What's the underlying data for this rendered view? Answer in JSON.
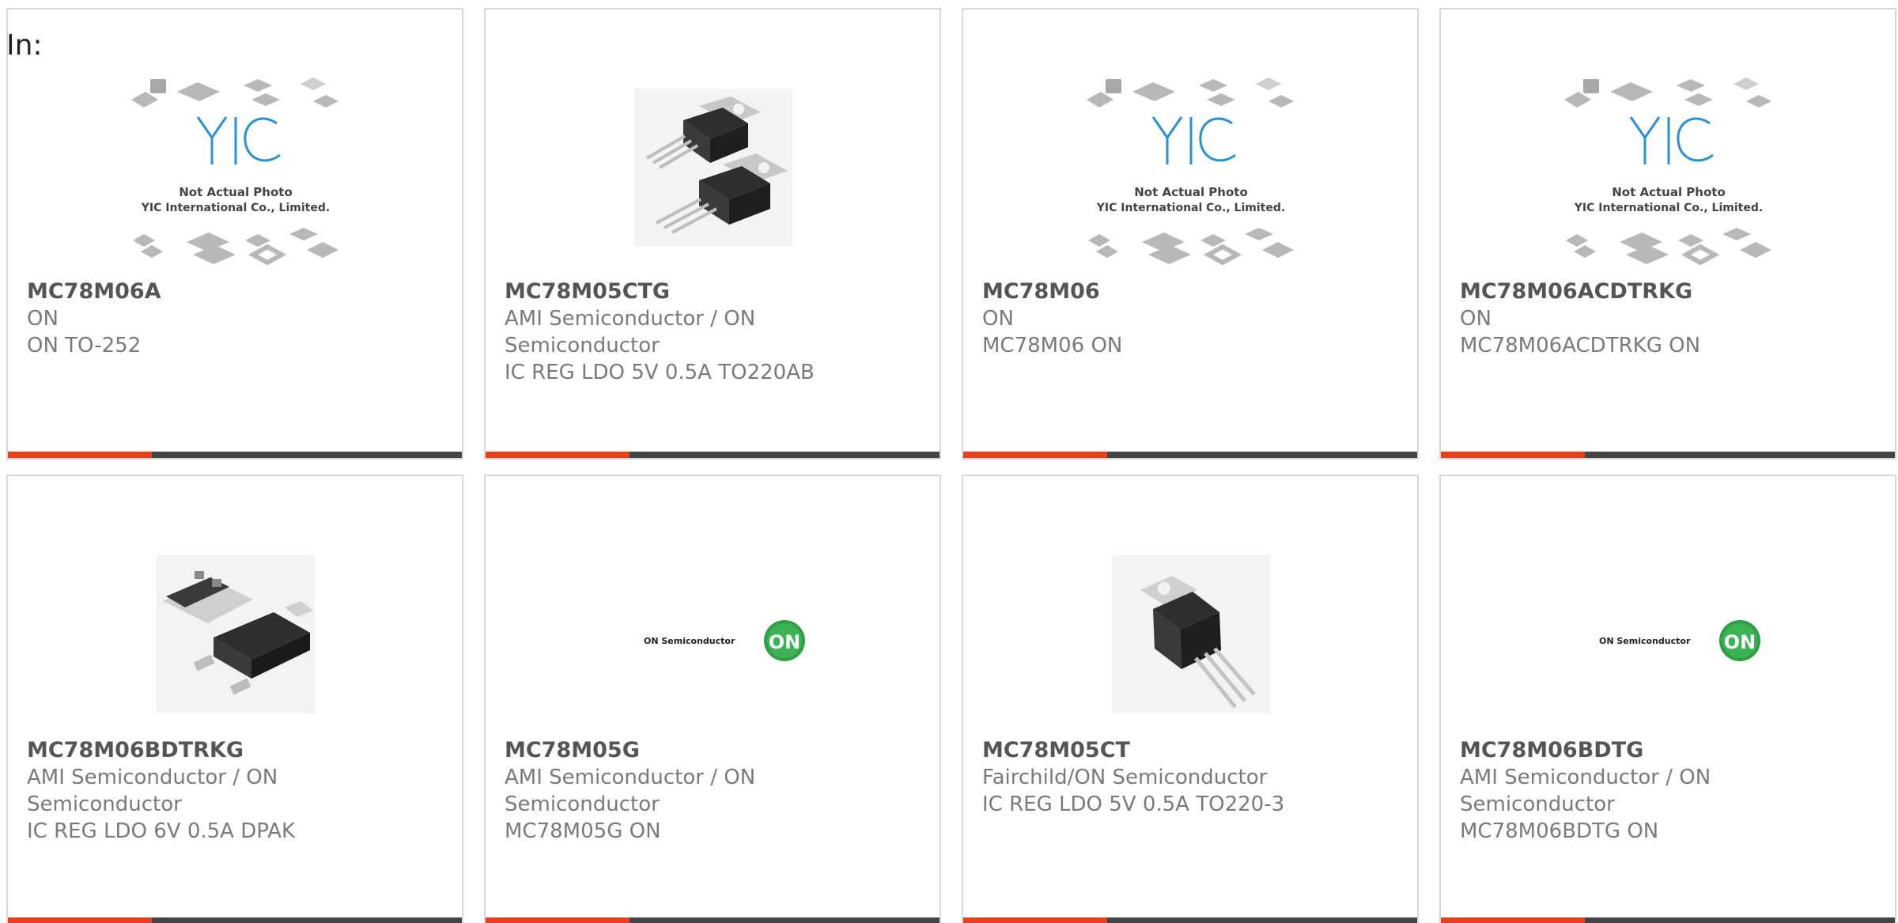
{
  "filter_label": "In:",
  "colors": {
    "accent": "#e8401c",
    "bar": "#444444",
    "part_number": "#555555",
    "text": "#7a7a7a",
    "on_logo_green": "#2f9e45",
    "yic_logo_blue": "#2b8fd6"
  },
  "placeholder": {
    "line1": "Not Actual Photo",
    "line2": "YIC International Co., Limited."
  },
  "on_logo_text": "ON Semiconductor",
  "on_logo_mark": "ON",
  "products": [
    {
      "part": "MC78M06A",
      "maker": "ON",
      "desc": "ON TO-252",
      "image": "yic-placeholder-icon"
    },
    {
      "part": "MC78M05CTG",
      "maker": "AMI Semiconductor / ON Semiconductor",
      "desc": "IC REG LDO 5V 0.5A TO220AB",
      "image": "to220-package-icon"
    },
    {
      "part": "MC78M06",
      "maker": "ON",
      "desc": "MC78M06 ON",
      "image": "yic-placeholder-icon"
    },
    {
      "part": "MC78M06ACDTRKG",
      "maker": "ON",
      "desc": "MC78M06ACDTRKG ON",
      "image": "yic-placeholder-icon"
    },
    {
      "part": "MC78M06BDTRKG",
      "maker": "AMI Semiconductor / ON Semiconductor",
      "desc": "IC REG LDO 6V 0.5A DPAK",
      "image": "dpak-package-icon"
    },
    {
      "part": "MC78M05G",
      "maker": "AMI Semiconductor / ON Semiconductor",
      "desc": "MC78M05G ON",
      "image": "on-semiconductor-logo"
    },
    {
      "part": "MC78M05CT",
      "maker": "Fairchild/ON Semiconductor",
      "desc": "IC REG LDO 5V 0.5A TO220-3",
      "image": "to220-single-icon"
    },
    {
      "part": "MC78M06BDTG",
      "maker": "AMI Semiconductor / ON Semiconductor",
      "desc": "MC78M06BDTG ON",
      "image": "on-semiconductor-logo"
    }
  ]
}
